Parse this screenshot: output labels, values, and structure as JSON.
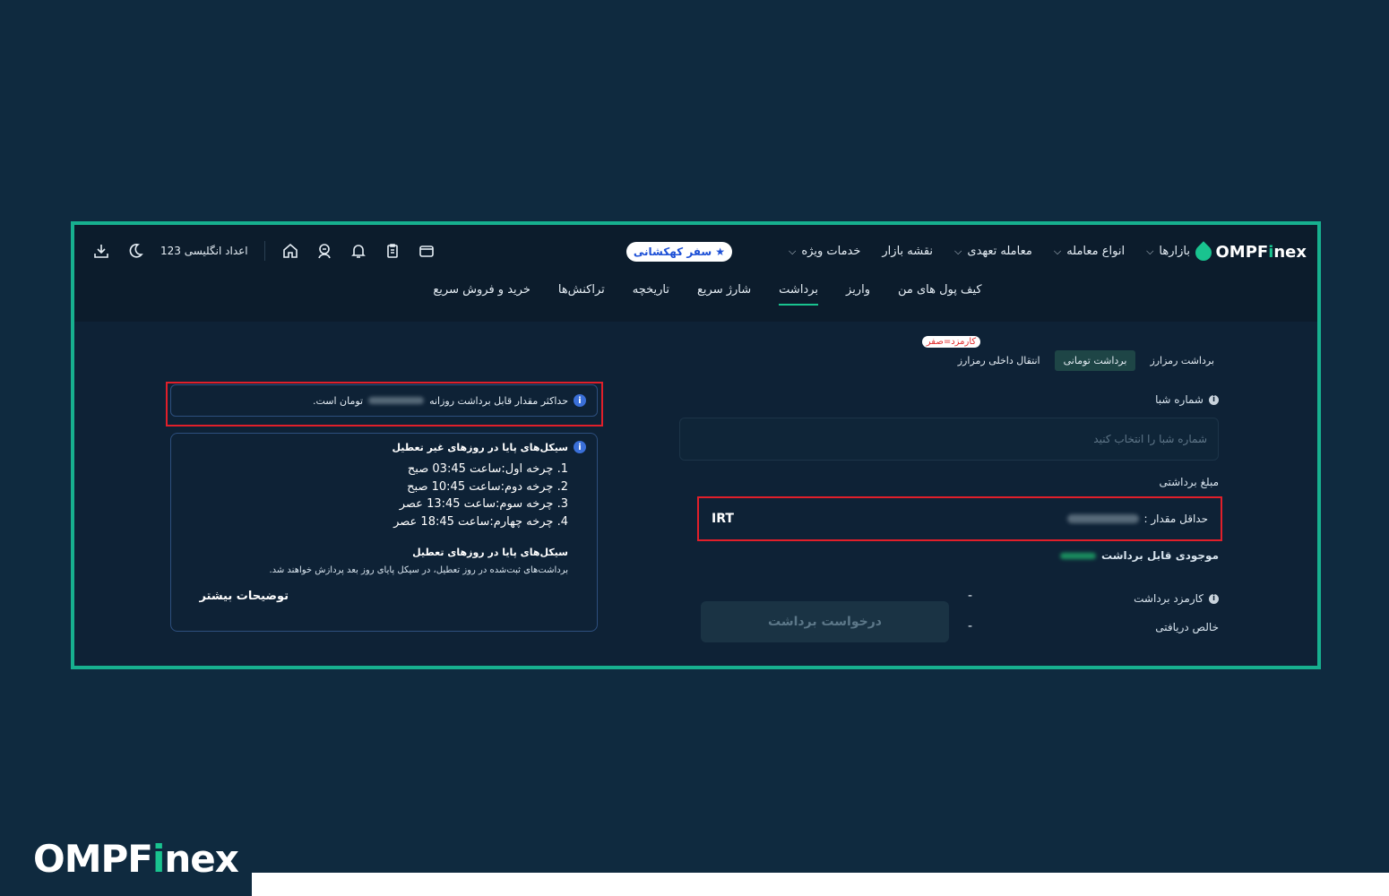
{
  "brand": {
    "name_prefix": "OMPF",
    "name_i": "i",
    "name_suffix": "nex"
  },
  "header": {
    "nav": [
      {
        "label": "بازارها",
        "dropdown": true
      },
      {
        "label": "انواع معامله",
        "dropdown": true
      },
      {
        "label": "معامله تعهدی",
        "dropdown": true
      },
      {
        "label": "نقشه بازار",
        "dropdown": false
      },
      {
        "label": "خدمات ویژه",
        "dropdown": true
      }
    ],
    "promo": "سفر کهکشانی",
    "digits_label": "اعداد انگلیسی 123"
  },
  "subnav": {
    "tabs": [
      "کیف پول های من",
      "واریز",
      "برداشت",
      "شارژ سریع",
      "تاریخچه",
      "تراکنش‌ها",
      "خرید و فروش سریع"
    ],
    "active": "برداشت"
  },
  "withdraw": {
    "tabs": [
      "برداشت رمزارز",
      "برداشت تومانی",
      "انتقال داخلی رمزارز"
    ],
    "active_tab": "برداشت تومانی",
    "fee_badge": "کارمزد=صفر",
    "sheba_label": "شماره شبا",
    "sheba_placeholder": "شماره شبا را انتخاب کنید",
    "amount_label": "مبلغ برداشتی",
    "min_label": "حداقل مقدار :",
    "currency": "IRT",
    "balance_label": "موجودی قابل برداشت",
    "fee_label": "کارمزد برداشت",
    "fee_value": "-",
    "net_label": "خالص دریافتی",
    "net_value": "-",
    "submit": "درخواست برداشت"
  },
  "notice": {
    "prefix": "حداکثر مقدار قابل برداشت روزانه",
    "suffix": "تومان است."
  },
  "cycles": {
    "title": "سیکل‌های پایا در روزهای غیر تعطیل",
    "items": [
      "1. چرخه اول:ساعت 03:45 صبح",
      "2. چرخه دوم:ساعت 10:45 صبح",
      "3. چرخه سوم:ساعت 13:45 عصر",
      "4. چرخه چهارم:ساعت 18:45 عصر"
    ],
    "holiday_title": "سیکل‌های پایا در روزهای تعطیل",
    "holiday_desc": "برداشت‌های ثبت‌شده در روز تعطیل، در سیکل پایای روز بعد پردازش خواهند شد.",
    "more": "توضیحات بیشتر"
  },
  "colors": {
    "accent": "#19c38f",
    "highlight": "#e11f2a",
    "background": "#0f2a3f"
  }
}
